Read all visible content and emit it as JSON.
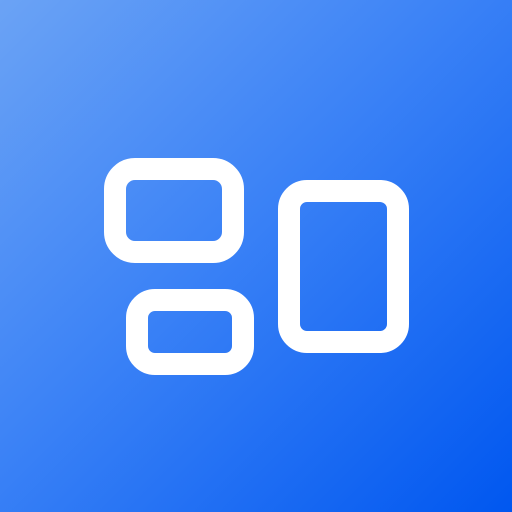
{
  "app_icon": {
    "icon_name": "layout-widgets-icon",
    "background_gradient": [
      "#6ba3f5",
      "#3b82f6",
      "#0057f0"
    ],
    "glyph_color": "#ffffff"
  }
}
